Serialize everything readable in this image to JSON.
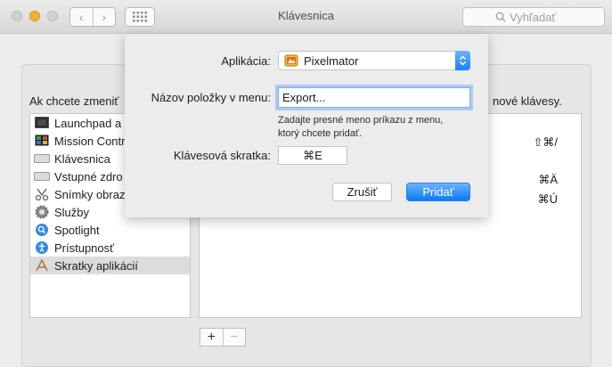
{
  "window": {
    "title": "Klávesnica",
    "search_placeholder": "Vyhľadať"
  },
  "pane": {
    "hint_left": "Ak chcete zmeniť",
    "hint_right": "nové klávesy.",
    "sidebar_items": [
      {
        "label": "Launchpad a",
        "icon": "launchpad-icon"
      },
      {
        "label": "Mission Contr",
        "icon": "mission-control-icon"
      },
      {
        "label": "Klávesnica",
        "icon": "keyboard-icon"
      },
      {
        "label": "Vstupné zdro",
        "icon": "input-sources-icon"
      },
      {
        "label": "Snímky obraz",
        "icon": "screenshot-icon"
      },
      {
        "label": "Služby",
        "icon": "services-gear-icon"
      },
      {
        "label": "Spotlight",
        "icon": "spotlight-icon"
      },
      {
        "label": "Prístupnosť",
        "icon": "accessibility-icon"
      },
      {
        "label": "Skratky aplikácií",
        "icon": "app-shortcuts-icon",
        "selected": true
      }
    ],
    "shortcut_keys": [
      "⇧⌘/",
      "⌘Ä",
      "⌘Ú"
    ],
    "add_label": "+",
    "remove_label": "−"
  },
  "sheet": {
    "app_label": "Aplikácia:",
    "app_value": "Pixelmator",
    "menu_label": "Názov položky v menu:",
    "menu_value": "Export...",
    "help_line1": "Zadajte presné meno príkazu z menu,",
    "help_line2": "ktorý chcete pridať.",
    "shortcut_label": "Klávesová skratka:",
    "shortcut_value": "⌘E",
    "cancel_label": "Zrušiť",
    "add_label": "Pridať"
  },
  "colors": {
    "accent": "#1a82fb",
    "minimize": "#f5b22e"
  }
}
